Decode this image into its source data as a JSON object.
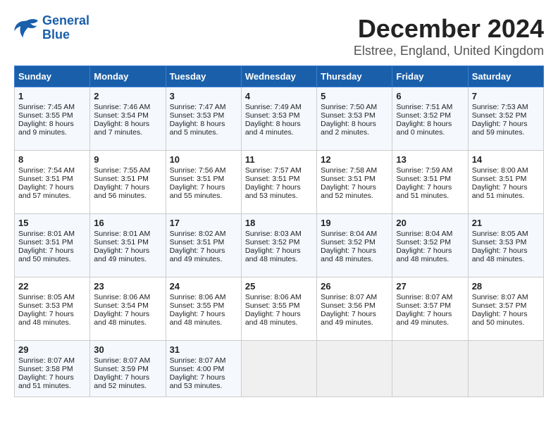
{
  "logo": {
    "line1": "General",
    "line2": "Blue"
  },
  "title": "December 2024",
  "subtitle": "Elstree, England, United Kingdom",
  "headers": [
    "Sunday",
    "Monday",
    "Tuesday",
    "Wednesday",
    "Thursday",
    "Friday",
    "Saturday"
  ],
  "weeks": [
    [
      {
        "day": "1",
        "sunrise": "7:45 AM",
        "sunset": "3:55 PM",
        "daylight": "8 hours and 9 minutes."
      },
      {
        "day": "2",
        "sunrise": "7:46 AM",
        "sunset": "3:54 PM",
        "daylight": "8 hours and 7 minutes."
      },
      {
        "day": "3",
        "sunrise": "7:47 AM",
        "sunset": "3:53 PM",
        "daylight": "8 hours and 5 minutes."
      },
      {
        "day": "4",
        "sunrise": "7:49 AM",
        "sunset": "3:53 PM",
        "daylight": "8 hours and 4 minutes."
      },
      {
        "day": "5",
        "sunrise": "7:50 AM",
        "sunset": "3:53 PM",
        "daylight": "8 hours and 2 minutes."
      },
      {
        "day": "6",
        "sunrise": "7:51 AM",
        "sunset": "3:52 PM",
        "daylight": "8 hours and 0 minutes."
      },
      {
        "day": "7",
        "sunrise": "7:53 AM",
        "sunset": "3:52 PM",
        "daylight": "7 hours and 59 minutes."
      }
    ],
    [
      {
        "day": "8",
        "sunrise": "7:54 AM",
        "sunset": "3:51 PM",
        "daylight": "7 hours and 57 minutes."
      },
      {
        "day": "9",
        "sunrise": "7:55 AM",
        "sunset": "3:51 PM",
        "daylight": "7 hours and 56 minutes."
      },
      {
        "day": "10",
        "sunrise": "7:56 AM",
        "sunset": "3:51 PM",
        "daylight": "7 hours and 55 minutes."
      },
      {
        "day": "11",
        "sunrise": "7:57 AM",
        "sunset": "3:51 PM",
        "daylight": "7 hours and 53 minutes."
      },
      {
        "day": "12",
        "sunrise": "7:58 AM",
        "sunset": "3:51 PM",
        "daylight": "7 hours and 52 minutes."
      },
      {
        "day": "13",
        "sunrise": "7:59 AM",
        "sunset": "3:51 PM",
        "daylight": "7 hours and 51 minutes."
      },
      {
        "day": "14",
        "sunrise": "8:00 AM",
        "sunset": "3:51 PM",
        "daylight": "7 hours and 51 minutes."
      }
    ],
    [
      {
        "day": "15",
        "sunrise": "8:01 AM",
        "sunset": "3:51 PM",
        "daylight": "7 hours and 50 minutes."
      },
      {
        "day": "16",
        "sunrise": "8:01 AM",
        "sunset": "3:51 PM",
        "daylight": "7 hours and 49 minutes."
      },
      {
        "day": "17",
        "sunrise": "8:02 AM",
        "sunset": "3:51 PM",
        "daylight": "7 hours and 49 minutes."
      },
      {
        "day": "18",
        "sunrise": "8:03 AM",
        "sunset": "3:52 PM",
        "daylight": "7 hours and 48 minutes."
      },
      {
        "day": "19",
        "sunrise": "8:04 AM",
        "sunset": "3:52 PM",
        "daylight": "7 hours and 48 minutes."
      },
      {
        "day": "20",
        "sunrise": "8:04 AM",
        "sunset": "3:52 PM",
        "daylight": "7 hours and 48 minutes."
      },
      {
        "day": "21",
        "sunrise": "8:05 AM",
        "sunset": "3:53 PM",
        "daylight": "7 hours and 48 minutes."
      }
    ],
    [
      {
        "day": "22",
        "sunrise": "8:05 AM",
        "sunset": "3:53 PM",
        "daylight": "7 hours and 48 minutes."
      },
      {
        "day": "23",
        "sunrise": "8:06 AM",
        "sunset": "3:54 PM",
        "daylight": "7 hours and 48 minutes."
      },
      {
        "day": "24",
        "sunrise": "8:06 AM",
        "sunset": "3:55 PM",
        "daylight": "7 hours and 48 minutes."
      },
      {
        "day": "25",
        "sunrise": "8:06 AM",
        "sunset": "3:55 PM",
        "daylight": "7 hours and 48 minutes."
      },
      {
        "day": "26",
        "sunrise": "8:07 AM",
        "sunset": "3:56 PM",
        "daylight": "7 hours and 49 minutes."
      },
      {
        "day": "27",
        "sunrise": "8:07 AM",
        "sunset": "3:57 PM",
        "daylight": "7 hours and 49 minutes."
      },
      {
        "day": "28",
        "sunrise": "8:07 AM",
        "sunset": "3:57 PM",
        "daylight": "7 hours and 50 minutes."
      }
    ],
    [
      {
        "day": "29",
        "sunrise": "8:07 AM",
        "sunset": "3:58 PM",
        "daylight": "7 hours and 51 minutes."
      },
      {
        "day": "30",
        "sunrise": "8:07 AM",
        "sunset": "3:59 PM",
        "daylight": "7 hours and 52 minutes."
      },
      {
        "day": "31",
        "sunrise": "8:07 AM",
        "sunset": "4:00 PM",
        "daylight": "7 hours and 53 minutes."
      },
      null,
      null,
      null,
      null
    ]
  ],
  "labels": {
    "sunrise": "Sunrise:",
    "sunset": "Sunset:",
    "daylight": "Daylight:"
  }
}
